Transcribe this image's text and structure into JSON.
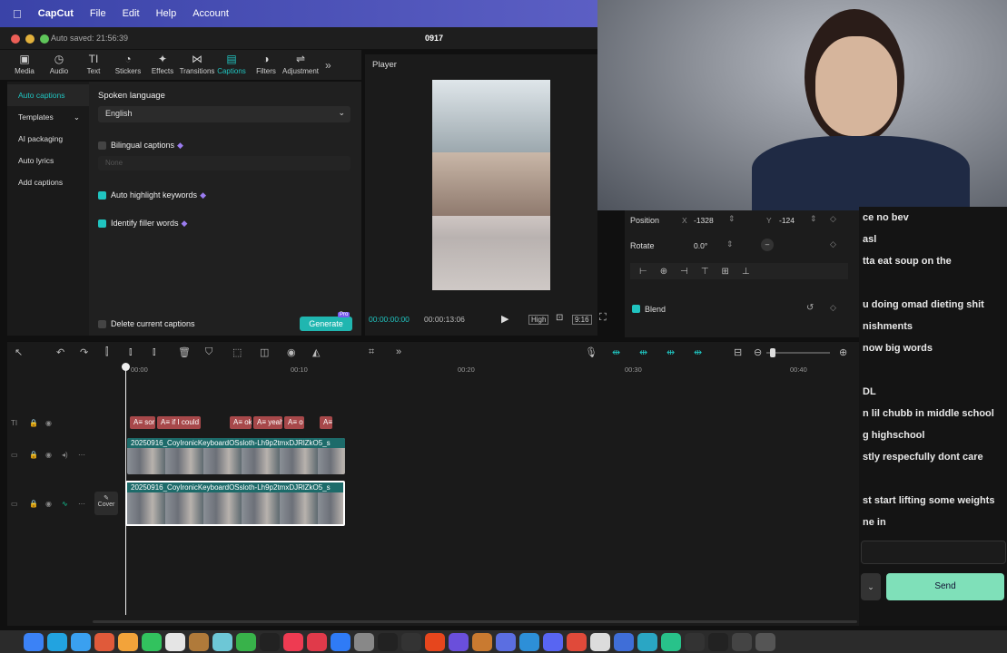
{
  "menubar": {
    "apple": "",
    "app": "CapCut",
    "items": [
      "File",
      "Edit",
      "Help",
      "Account"
    ]
  },
  "titlebar": {
    "autosave": "Auto saved: 21:56:39",
    "project": "0917"
  },
  "toolbar": {
    "items": [
      {
        "label": "Media",
        "icon": "media-icon",
        "active": false
      },
      {
        "label": "Audio",
        "icon": "audio-icon",
        "active": false
      },
      {
        "label": "Text",
        "icon": "text-icon",
        "active": false
      },
      {
        "label": "Stickers",
        "icon": "stickers-icon",
        "active": false
      },
      {
        "label": "Effects",
        "icon": "effects-icon",
        "active": false
      },
      {
        "label": "Transitions",
        "icon": "transitions-icon",
        "active": false
      },
      {
        "label": "Captions",
        "icon": "captions-icon",
        "active": true
      },
      {
        "label": "Filters",
        "icon": "filters-icon",
        "active": false
      },
      {
        "label": "Adjustment",
        "icon": "adjustment-icon",
        "active": false
      }
    ],
    "more": "»"
  },
  "left_panel": {
    "items": [
      {
        "label": "Auto captions",
        "active": true
      },
      {
        "label": "Templates",
        "active": false
      },
      {
        "label": "AI packaging",
        "active": false
      },
      {
        "label": "Auto lyrics",
        "active": false
      },
      {
        "label": "Add captions",
        "active": false
      }
    ]
  },
  "captions": {
    "spoken_language_label": "Spoken language",
    "language_value": "English",
    "bilingual_label": "Bilingual captions",
    "bilingual_none": "None",
    "highlight_label": "Auto highlight keywords",
    "filler_label": "Identify filler words",
    "delete_label": "Delete current captions",
    "generate_label": "Generate",
    "pro_badge": "Pro"
  },
  "player": {
    "title": "Player",
    "time_current": "00:00:00:00",
    "time_total": "00:00:13:06",
    "quality": "High",
    "ratio": "9:16"
  },
  "props": {
    "position_label": "Position",
    "x_label": "X",
    "x_value": "-1328",
    "y_label": "Y",
    "y_value": "-124",
    "rotate_label": "Rotate",
    "rotate_value": "0.0°",
    "rotate_dial": "–",
    "blend_label": "Blend"
  },
  "chat": {
    "lines": [
      "ce no bev",
      "asl",
      "tta eat soup on the",
      "",
      "u doing omad dieting shit",
      "nishments",
      "now big words",
      "",
      "DL",
      "n lil chubb in middle school",
      "g highschool",
      "stly respecfully dont care",
      "",
      "st start lifting some weights",
      "ne in"
    ],
    "send_label": "Send"
  },
  "timeline": {
    "ruler": [
      "00:00",
      "00:10",
      "00:20",
      "00:30",
      "00:40"
    ],
    "text_clips": [
      "A≡ sor",
      "A≡ if I could",
      "A≡ ok",
      "A≡ yeah",
      "A≡ o",
      "A≡"
    ],
    "video_clip_1": "20250916_CoyIronicKeyboardOSsloth-Lh9p2tmxDJRlZkO5_s",
    "video_clip_2": "20250916_CoyIronicKeyboardOSsloth-Lh9p2tmxDJRlZkO5_s",
    "cover_label": "Cover"
  },
  "colors": {
    "accent": "#20c4c0",
    "caption_clip": "#a7484a",
    "menubar": "#4a50b8"
  }
}
